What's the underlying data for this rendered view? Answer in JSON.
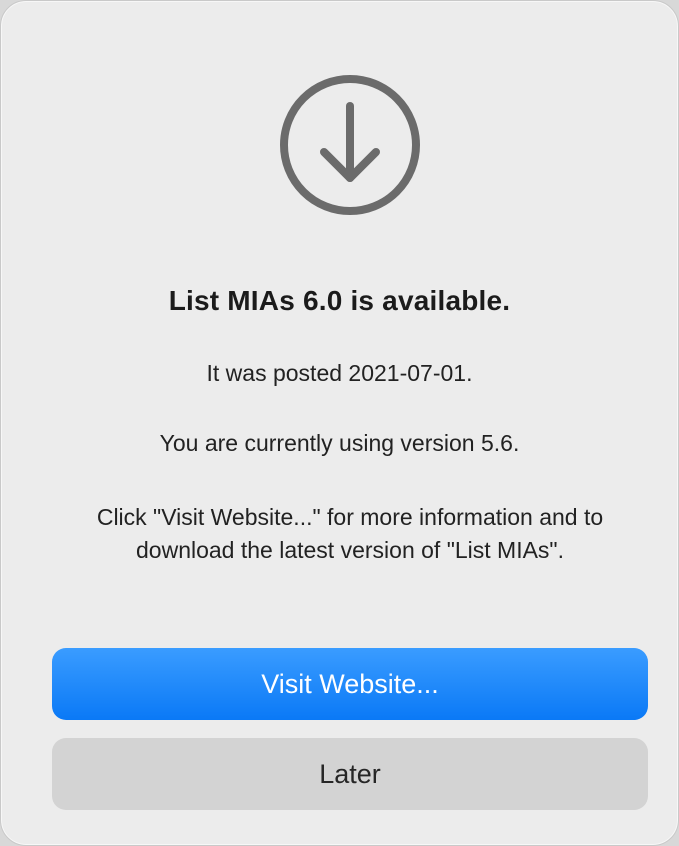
{
  "dialog": {
    "icon": "download-arrow-circle-icon",
    "title": "List MIAs 6.0 is available.",
    "posted": "It was posted 2021-07-01.",
    "current": "You are currently using version 5.6.",
    "info": "Click \"Visit Website...\" for more information and to download the latest version of \"List MIAs\".",
    "primary_button": "Visit Website...",
    "secondary_button": "Later"
  },
  "colors": {
    "accent": "#0a79f6",
    "background": "#ececec",
    "icon": "#6b6b6b"
  }
}
